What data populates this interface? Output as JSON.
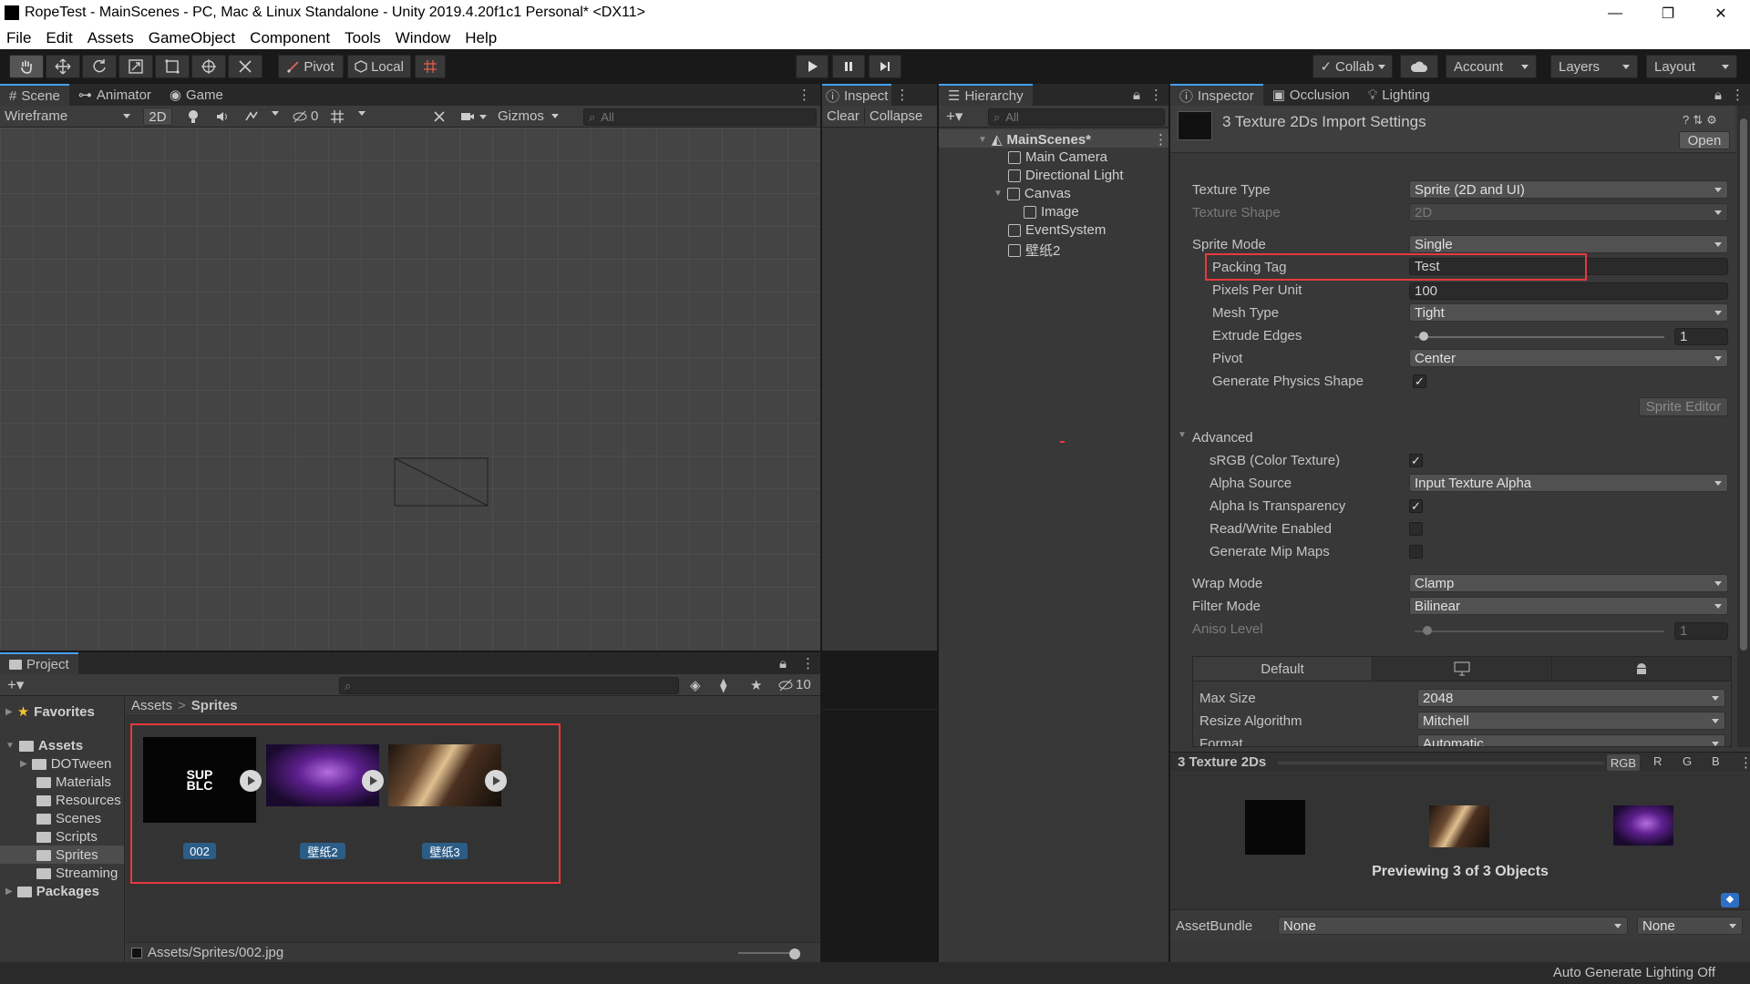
{
  "window": {
    "title": "RopeTest - MainScenes - PC, Mac & Linux Standalone - Unity 2019.4.20f1c1 Personal* <DX11>",
    "controls": [
      "—",
      "❐",
      "✕"
    ]
  },
  "menu": [
    "File",
    "Edit",
    "Assets",
    "GameObject",
    "Component",
    "Tools",
    "Window",
    "Help"
  ],
  "toolbar": {
    "pivot_label": "Pivot",
    "local_label": "Local",
    "collab_label": "Collab",
    "account_label": "Account",
    "layers_label": "Layers",
    "layout_label": "Layout"
  },
  "scene": {
    "tabs": [
      "Scene",
      "Animator",
      "Game"
    ],
    "draw_mode": "Wireframe",
    "mode_2d": "2D",
    "hidden_count": "0",
    "gizmos_label": "Gizmos",
    "search_placeholder": "All"
  },
  "console": {
    "tab_label": "Inspect",
    "clear_label": "Clear",
    "collapse_label": "Collapse"
  },
  "hierarchy": {
    "tab_label": "Hierarchy",
    "search_placeholder": "All",
    "scene_name": "MainScenes*",
    "items": [
      "Main Camera",
      "Directional Light",
      "Canvas",
      "Image",
      "EventSystem",
      "壁纸2"
    ]
  },
  "inspector": {
    "tabs": [
      "Inspector",
      "Occlusion",
      "Lighting"
    ],
    "header_title": "3 Texture 2Ds Import Settings",
    "open_label": "Open",
    "texture_type_label": "Texture Type",
    "texture_type_value": "Sprite (2D and UI)",
    "texture_shape_label": "Texture Shape",
    "texture_shape_value": "2D",
    "sprite_mode_label": "Sprite Mode",
    "sprite_mode_value": "Single",
    "packing_tag_label": "Packing Tag",
    "packing_tag_value": "Test",
    "ppu_label": "Pixels Per Unit",
    "ppu_value": "100",
    "mesh_type_label": "Mesh Type",
    "mesh_type_value": "Tight",
    "extrude_label": "Extrude Edges",
    "extrude_value": "1",
    "pivot_label": "Pivot",
    "pivot_value": "Center",
    "physics_shape_label": "Generate Physics Shape",
    "physics_shape_checked": "✓",
    "sprite_editor_label": "Sprite Editor",
    "advanced_label": "Advanced",
    "srgb_label": "sRGB (Color Texture)",
    "srgb_checked": "✓",
    "alpha_source_label": "Alpha Source",
    "alpha_source_value": "Input Texture Alpha",
    "alpha_transparency_label": "Alpha Is Transparency",
    "alpha_transparency_checked": "✓",
    "readwrite_label": "Read/Write Enabled",
    "mipmaps_label": "Generate Mip Maps",
    "wrap_label": "Wrap Mode",
    "wrap_value": "Clamp",
    "filter_label": "Filter Mode",
    "filter_value": "Bilinear",
    "aniso_label": "Aniso Level",
    "aniso_value": "1",
    "platform_default": "Default",
    "max_size_label": "Max Size",
    "max_size_value": "2048",
    "resize_label": "Resize Algorithm",
    "resize_value": "Mitchell",
    "format_label": "Format",
    "format_value": "Automatic"
  },
  "preview": {
    "title": "3 Texture 2Ds",
    "channels": [
      "RGB",
      "R",
      "G",
      "B"
    ],
    "caption": "Previewing 3 of 3 Objects",
    "assetbundle_label": "AssetBundle",
    "assetbundle_value": "None",
    "variant_value": "None"
  },
  "project": {
    "tab_label": "Project",
    "hidden_count": "10",
    "favorites_label": "Favorites",
    "assets_label": "Assets",
    "folders": [
      "DOTween",
      "Materials",
      "Resources",
      "Scenes",
      "Scripts",
      "Sprites",
      "Streaming"
    ],
    "packages_label": "Packages",
    "breadcrumb": [
      "Assets",
      "Sprites"
    ],
    "breadcrumb_sep": ">",
    "assets": [
      "002",
      "壁纸2",
      "壁纸3"
    ],
    "thumb_text": "SUP BLC",
    "status_path": "Assets/Sprites/002.jpg"
  },
  "statusbar": {
    "text": "Auto Generate Lighting Off"
  }
}
